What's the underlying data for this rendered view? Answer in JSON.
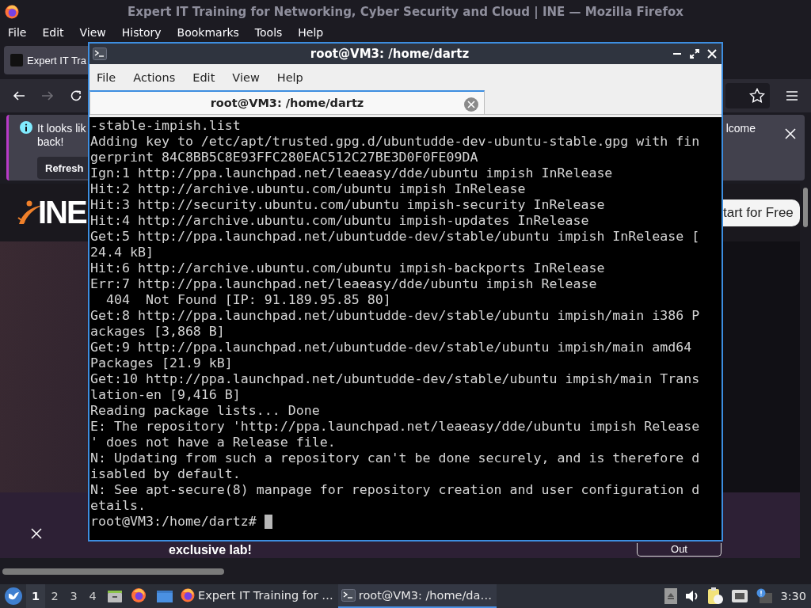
{
  "browser": {
    "title": "Expert IT Training for Networking, Cyber Security and Cloud | INE — Mozilla Firefox",
    "menu": [
      "File",
      "Edit",
      "View",
      "History",
      "Bookmarks",
      "Tools",
      "Help"
    ],
    "tab": {
      "label": "Expert IT Tra"
    },
    "notification": {
      "lines": [
        "It looks lik",
        "back!"
      ],
      "button": "Refresh",
      "text_right": "lcome"
    },
    "page": {
      "logo": "INE",
      "cta": "tart for Free",
      "banner": {
        "text": "exclusive lab!",
        "button": "Out"
      }
    }
  },
  "terminal": {
    "title": "root@VM3: /home/dartz",
    "menu": [
      "File",
      "Actions",
      "Edit",
      "View",
      "Help"
    ],
    "tabs": [
      {
        "label": "root@VM3: /home/dartz",
        "selected": true
      }
    ],
    "lines": [
      "-stable-impish.list",
      "Adding key to /etc/apt/trusted.gpg.d/ubuntudde-dev-ubuntu-stable.gpg with fin",
      "gerprint 84C8BB5C8E93FFC280EAC512C27BE3D0F0FE09DA",
      "Ign:1 http://ppa.launchpad.net/leaeasy/dde/ubuntu impish InRelease",
      "Hit:2 http://archive.ubuntu.com/ubuntu impish InRelease",
      "Hit:3 http://security.ubuntu.com/ubuntu impish-security InRelease",
      "Hit:4 http://archive.ubuntu.com/ubuntu impish-updates InRelease",
      "Get:5 http://ppa.launchpad.net/ubuntudde-dev/stable/ubuntu impish InRelease [",
      "24.4 kB]",
      "Hit:6 http://archive.ubuntu.com/ubuntu impish-backports InRelease",
      "Err:7 http://ppa.launchpad.net/leaeasy/dde/ubuntu impish Release",
      "  404  Not Found [IP: 91.189.95.85 80]",
      "Get:8 http://ppa.launchpad.net/ubuntudde-dev/stable/ubuntu impish/main i386 P",
      "ackages [3,868 B]",
      "Get:9 http://ppa.launchpad.net/ubuntudde-dev/stable/ubuntu impish/main amd64",
      "Packages [21.9 kB]",
      "Get:10 http://ppa.launchpad.net/ubuntudde-dev/stable/ubuntu impish/main Trans",
      "lation-en [9,416 B]",
      "Reading package lists... Done",
      "E: The repository 'http://ppa.launchpad.net/leaeasy/dde/ubuntu impish Release",
      "' does not have a Release file.",
      "N: Updating from such a repository can't be done securely, and is therefore d",
      "isabled by default.",
      "N: See apt-secure(8) manpage for repository creation and user configuration d",
      "etails."
    ],
    "prompt": "root@VM3:/home/dartz#"
  },
  "taskbar": {
    "workspaces": [
      {
        "label": "1",
        "selected": true
      },
      {
        "label": "2",
        "selected": false
      },
      {
        "label": "3",
        "selected": false
      },
      {
        "label": "4",
        "selected": false
      }
    ],
    "tasks": [
      {
        "kind": "browser",
        "label": "Expert IT Training for …",
        "selected": false
      },
      {
        "kind": "terminal",
        "label": "root@VM3: /home/da…",
        "selected": true
      }
    ],
    "clock": "3:30"
  }
}
